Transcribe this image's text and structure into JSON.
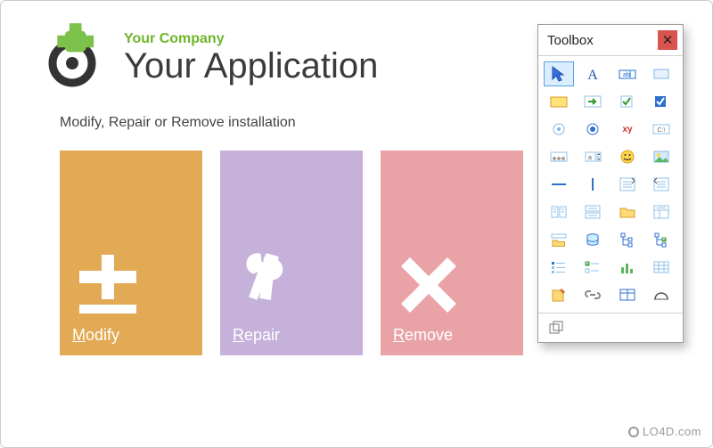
{
  "header": {
    "company": "Your Company",
    "app": "Your Application"
  },
  "subtitle": "Modify, Repair or Remove installation",
  "tiles": {
    "modify": {
      "label": "Modify",
      "accel": "M"
    },
    "repair": {
      "label": "Repair",
      "accel": "R"
    },
    "remove": {
      "label": "Remove",
      "accel": "R"
    }
  },
  "toolbox": {
    "title": "Toolbox",
    "tools": [
      "pointer",
      "label",
      "textbox",
      "panel",
      "groupbox",
      "button-green-arrow",
      "checkbox",
      "checkbox-checked",
      "radio-empty",
      "radio-selected",
      "hyperlink-xy",
      "path-field",
      "password-field",
      "updown",
      "emoji-picker",
      "image-picker",
      "hrule",
      "vrule",
      "list-indent-right",
      "list-indent-left",
      "column-layout",
      "row-layout",
      "folder-open",
      "list-detail",
      "folder-bar",
      "db-stack",
      "tree-view",
      "tree-check",
      "node-list",
      "check-list",
      "bar-chart",
      "grid",
      "note-pin",
      "link-chain",
      "table-frame",
      "arc-shape"
    ],
    "selected": "pointer",
    "footer_tool": "copy-stack"
  },
  "watermark": "LO4D.com",
  "colors": {
    "accent_green": "#6fb52b",
    "tile_modify": "#e2aa54",
    "tile_repair": "#c6b1da",
    "tile_remove": "#e9a3a7",
    "close_red": "#d9534f"
  }
}
